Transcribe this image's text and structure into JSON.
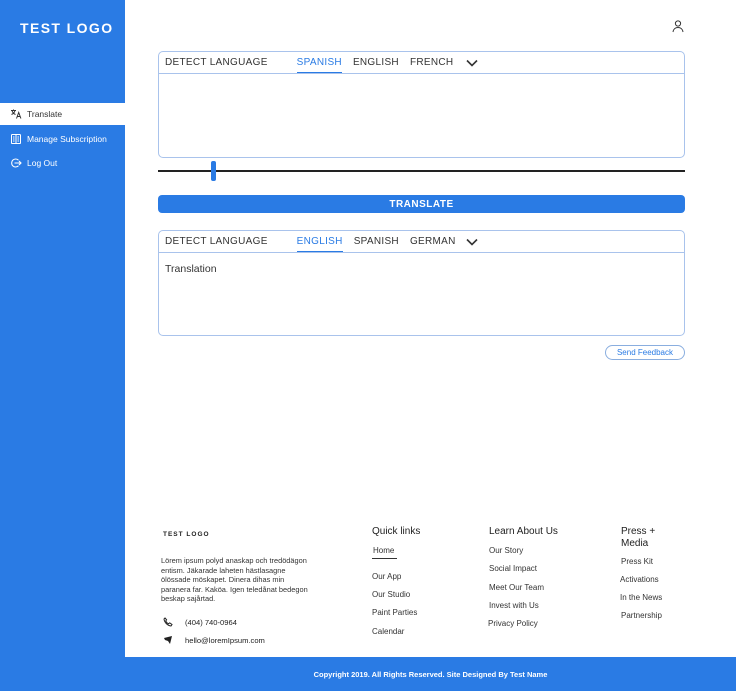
{
  "app": {
    "logo": "TEST LOGO"
  },
  "sidebar": {
    "items": [
      {
        "label": "Translate",
        "icon": "translate-icon",
        "active": true
      },
      {
        "label": "Manage Subscription",
        "icon": "subscription-icon",
        "active": false
      },
      {
        "label": "Log Out",
        "icon": "logout-icon",
        "active": false
      }
    ]
  },
  "header": {
    "user_icon": "user-icon"
  },
  "source_panel": {
    "tabs": [
      "DETECT LANGUAGE",
      "SPANISH",
      "ENGLISH",
      "FRENCH"
    ],
    "active_tab": "SPANISH",
    "value": "",
    "placeholder": ""
  },
  "slider": {
    "value": 0.1
  },
  "translate_button": {
    "label": "TRANSLATE"
  },
  "target_panel": {
    "tabs": [
      "DETECT LANGUAGE",
      "ENGLISH",
      "SPANISH",
      "GERMAN"
    ],
    "active_tab": "ENGLISH",
    "text": "Translation"
  },
  "feedback_button": {
    "label": "Send Feedback"
  },
  "footer": {
    "logo": "TEST LOGO",
    "description": "Lörem ipsum polyd anaskap och tredödägon entism. Jäkarade laheten hästlasagne ölössade möskapet. Dinera dihas min paranera far. Kaköa. Igen teledånat bedegon beskap sajårtad.",
    "phone": "(404) 740-0964",
    "email": "hello@loremIpsum.com",
    "columns": [
      {
        "title": "Quick links",
        "links": [
          "Home",
          "Our App",
          "Our Studio",
          "Paint Parties",
          "Calendar"
        ]
      },
      {
        "title": "Learn About Us",
        "links": [
          "Our Story",
          "Social Impact",
          "Meet Our Team",
          "Invest with Us",
          "Privacy Policy"
        ]
      },
      {
        "title": "Press + Media",
        "links": [
          "Press Kit",
          "Activations",
          "In the News",
          "Partnership"
        ]
      }
    ],
    "copyright": "Copyright 2019. All Rights Reserved. Site Designed By Test Name"
  },
  "colors": {
    "accent": "#2a7be4",
    "border": "#a9c3ec"
  }
}
